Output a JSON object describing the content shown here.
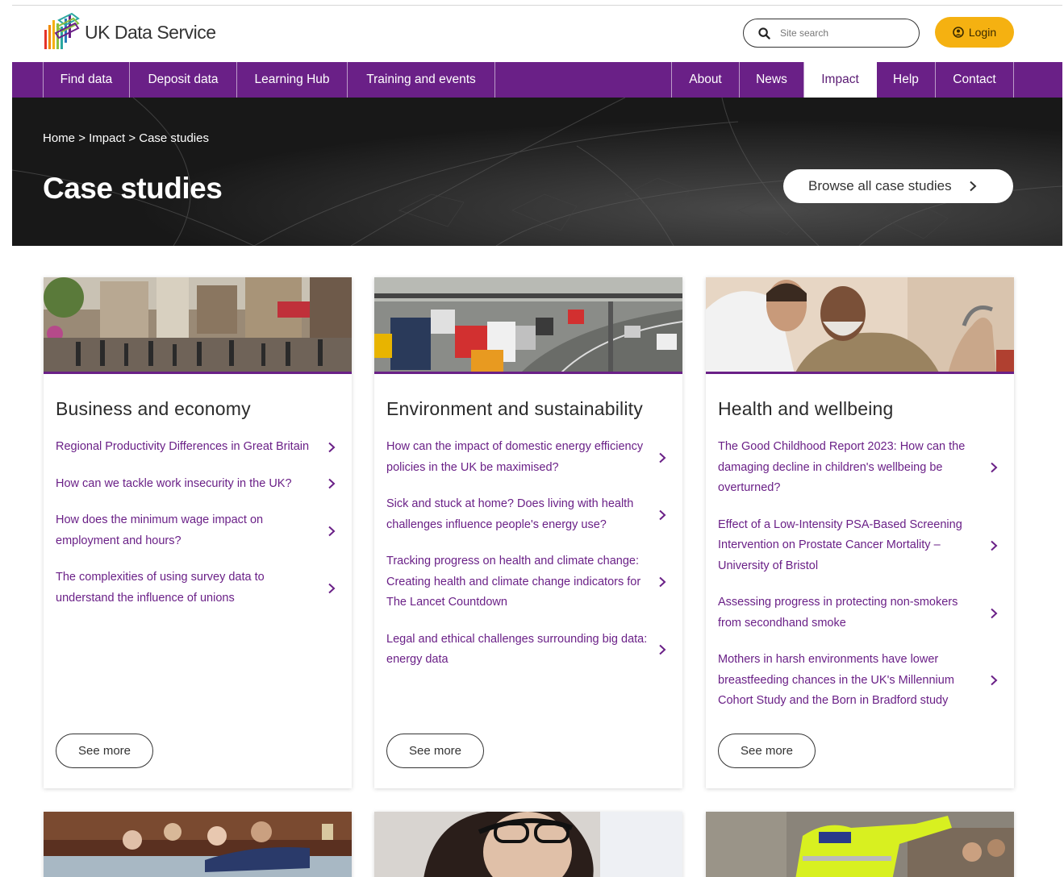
{
  "header": {
    "logo_text": "UK Data Service",
    "search_placeholder": "Site search",
    "login_label": "Login"
  },
  "nav": {
    "left": [
      "Find data",
      "Deposit data",
      "Learning Hub",
      "Training and events"
    ],
    "right": [
      "About",
      "News",
      "Impact",
      "Help",
      "Contact"
    ],
    "active": "Impact"
  },
  "hero": {
    "breadcrumb": [
      "Home",
      "Impact",
      "Case studies"
    ],
    "breadcrumb_separator": ">",
    "title": "Case studies",
    "browse_label": "Browse all case studies"
  },
  "cards": [
    {
      "title": "Business and economy",
      "links": [
        "Regional Productivity Differences in Great Britain",
        "How can we tackle work insecurity in the UK?",
        "How does the minimum wage impact on employment and hours?",
        "The complexities of using survey data to understand the influence of unions"
      ],
      "see_more": "See more"
    },
    {
      "title": "Environment and sustainability",
      "links": [
        "How can the impact of domestic energy efficiency policies in the UK be maximised?",
        "Sick and stuck at home? Does living with health challenges influence people's energy use?",
        "Tracking progress on health and climate change: Creating health and climate change indicators for The Lancet Countdown",
        "Legal and ethical challenges surrounding big data: energy data"
      ],
      "see_more": "See more"
    },
    {
      "title": "Health and wellbeing",
      "links": [
        "The Good Childhood Report 2023: How can the damaging decline in children's wellbeing be overturned?",
        "Effect of a Low-Intensity PSA-Based Screening Intervention on Prostate Cancer Mortality – University of Bristol",
        "Assessing progress in protecting non-smokers from secondhand smoke",
        "Mothers in harsh environments have lower breastfeeding chances in the UK's Millennium Cohort Study and the Born in Bradford study"
      ],
      "see_more": "See more"
    }
  ],
  "colors": {
    "brand_purple": "#6a2087",
    "accent_yellow": "#f5b111",
    "hero_dark": "#1c1c1c"
  }
}
